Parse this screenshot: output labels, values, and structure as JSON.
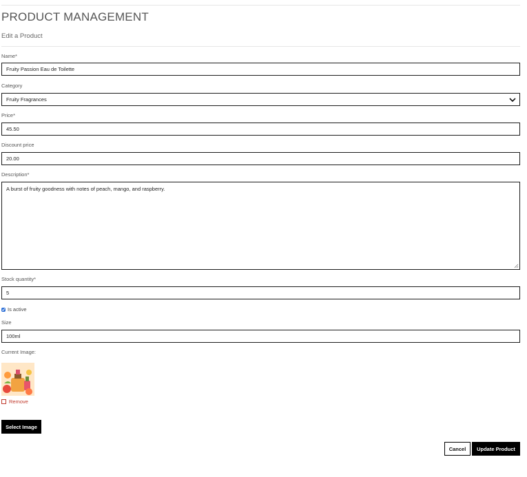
{
  "header": {
    "title": "PRODUCT MANAGEMENT",
    "subtitle": "Edit a Product"
  },
  "form": {
    "name": {
      "label": "Name*",
      "value": "Fruity Passion Eau de Toilette"
    },
    "category": {
      "label": "Category",
      "selected": "Fruity Fragrances",
      "icon": "chevron-down-icon"
    },
    "price": {
      "label": "Price*",
      "value": "45.50"
    },
    "discount_price": {
      "label": "Discount price",
      "value": "20.00"
    },
    "description": {
      "label": "Description*",
      "value": "A burst of fruity goodness with notes of peach, mango, and raspberry."
    },
    "stock_quantity": {
      "label": "Stock quantity*",
      "value": "5"
    },
    "is_active": {
      "label": "Is active",
      "checked": true
    },
    "size": {
      "label": "Size",
      "value": "100ml"
    },
    "current_image": {
      "label": "Current Image:",
      "remove_label": "Remove"
    }
  },
  "buttons": {
    "select_image": "Select Image",
    "cancel": "Cancel",
    "update": "Update Product"
  },
  "colors": {
    "remove": "#c0392b",
    "button_dark": "#000000",
    "checkbox": "#2b6ed6"
  }
}
